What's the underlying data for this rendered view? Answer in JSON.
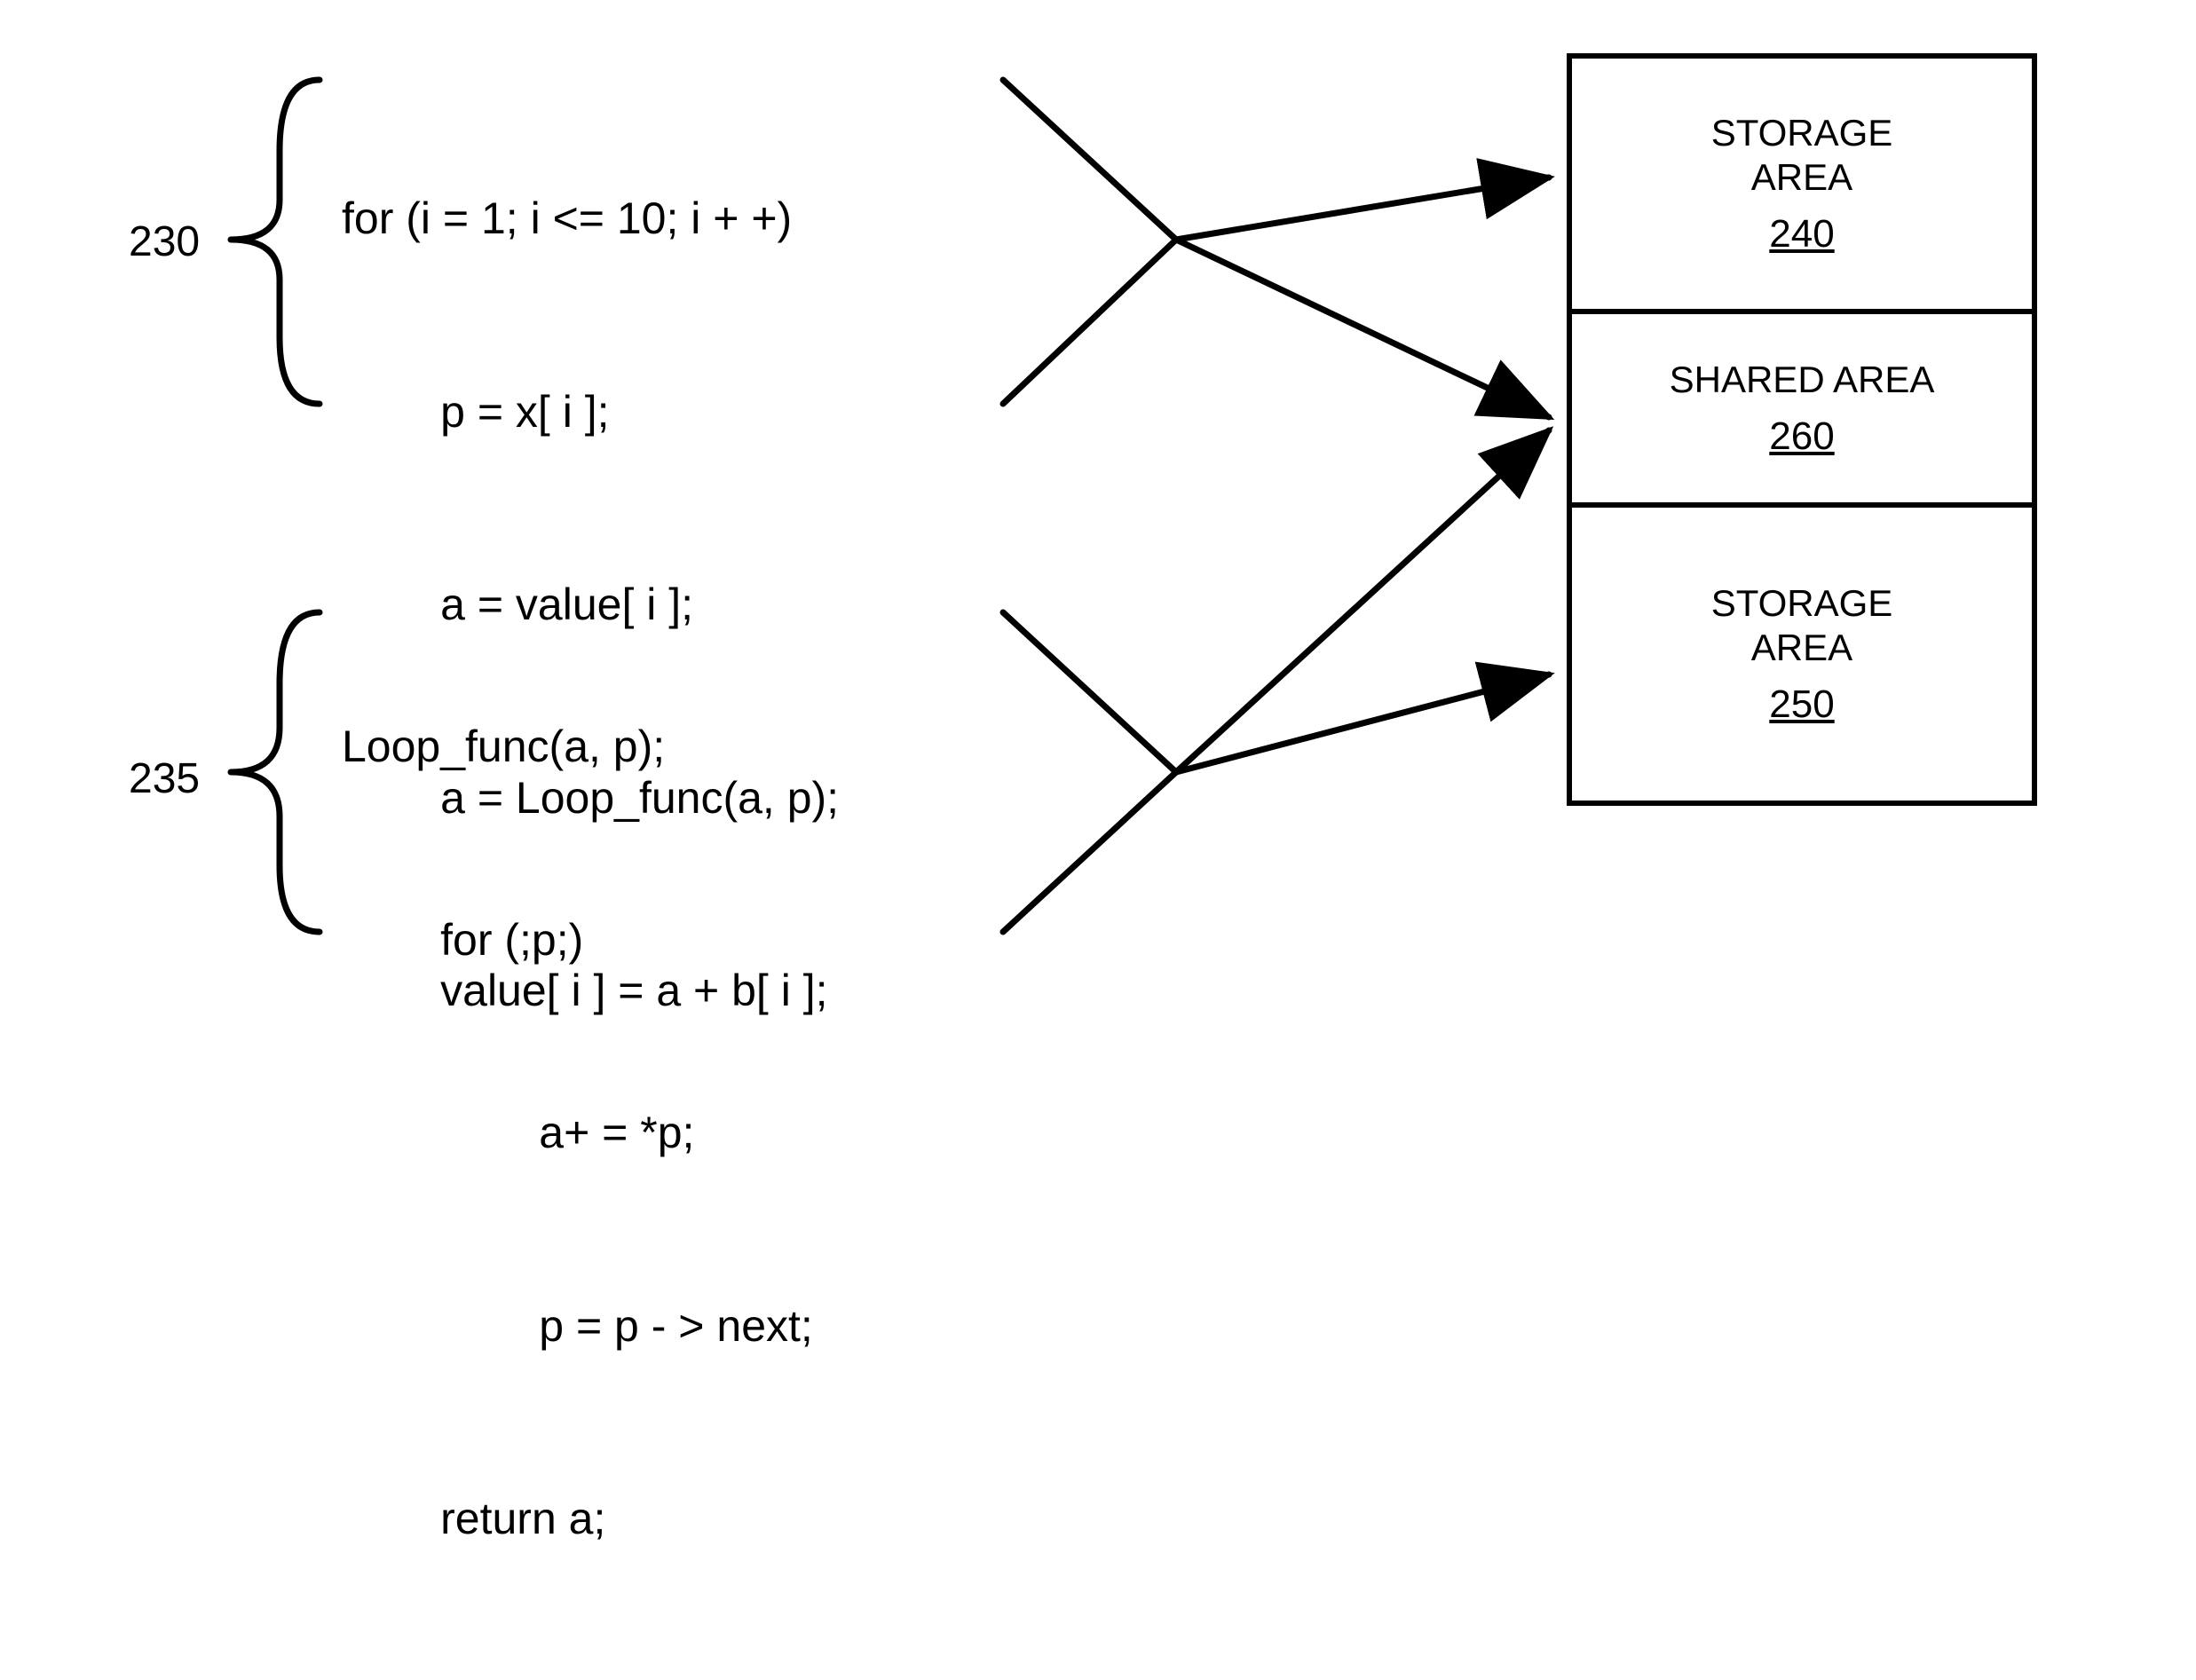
{
  "refs": {
    "top": "230",
    "bottom": "235"
  },
  "code_top": [
    "for (i = 1; i <= 10; i + +)",
    "        p = x[ i ];",
    "        a = value[ i ];",
    "        a = Loop_func(a, p);",
    "        value[ i ] = a + b[ i ];"
  ],
  "code_bottom": [
    "Loop_func(a, p);",
    "        for (;p;)",
    "                a+ = *p;",
    "                p = p - > next;",
    "        return a;"
  ],
  "boxes": {
    "b1": {
      "label": "STORAGE\nAREA",
      "num": "240"
    },
    "b2": {
      "label": "SHARED AREA",
      "num": "260"
    },
    "b3": {
      "label": "STORAGE\nAREA",
      "num": "250"
    }
  }
}
